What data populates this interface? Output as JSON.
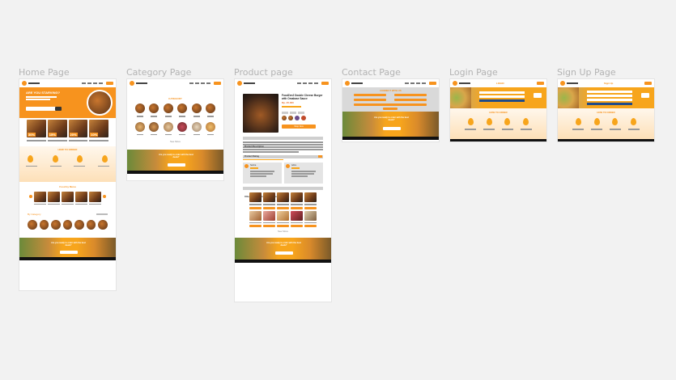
{
  "canvas": {
    "background": "#f2f2f2",
    "accent": "#f7931e"
  },
  "frames": [
    {
      "id": "home",
      "label": "Home Page"
    },
    {
      "id": "category",
      "label": "Category Page"
    },
    {
      "id": "product",
      "label": "Product page"
    },
    {
      "id": "contact",
      "label": "Contact Page"
    },
    {
      "id": "login",
      "label": "Login Page"
    },
    {
      "id": "signup",
      "label": "Sign Up Page"
    }
  ],
  "home": {
    "hero_title": "ARE YOU STARVING?",
    "how_to_order": "HOW TO ORDER",
    "food_by_menu": "Food by Menu",
    "by_category": "By Category",
    "discounts": [
      "30%",
      "15%",
      "20%",
      "10%"
    ],
    "cta_text": "Are you ready to order with the best deals?",
    "cta_button": "PROCEED TO ORDER"
  },
  "category": {
    "title": "CATEGORY",
    "see_more": "See More",
    "cta_text": "Are you ready to order with the best deals?"
  },
  "product": {
    "name": "FoodZen2 Double Cheese Burger with Omakase Sauce",
    "price": "Rp. 25.000",
    "buy_button": "Shop Now",
    "description_title": "Product Description",
    "rating_title": "Product Rating",
    "recommend_title": "Other Product Recommendations",
    "see_more": "See More",
    "reviewers": [
      "Sarina",
      "Adira"
    ],
    "cta_text": "Are you ready to order with the best deals?"
  },
  "contact": {
    "title": "CONNECT WITH US",
    "cta_text": "Are you ready to order with the best deals?"
  },
  "login": {
    "title": "LOGIN",
    "how_to_order": "HOW TO ORDER"
  },
  "signup": {
    "title": "Sign Up",
    "how_to_order": "HOW TO ORDER"
  }
}
